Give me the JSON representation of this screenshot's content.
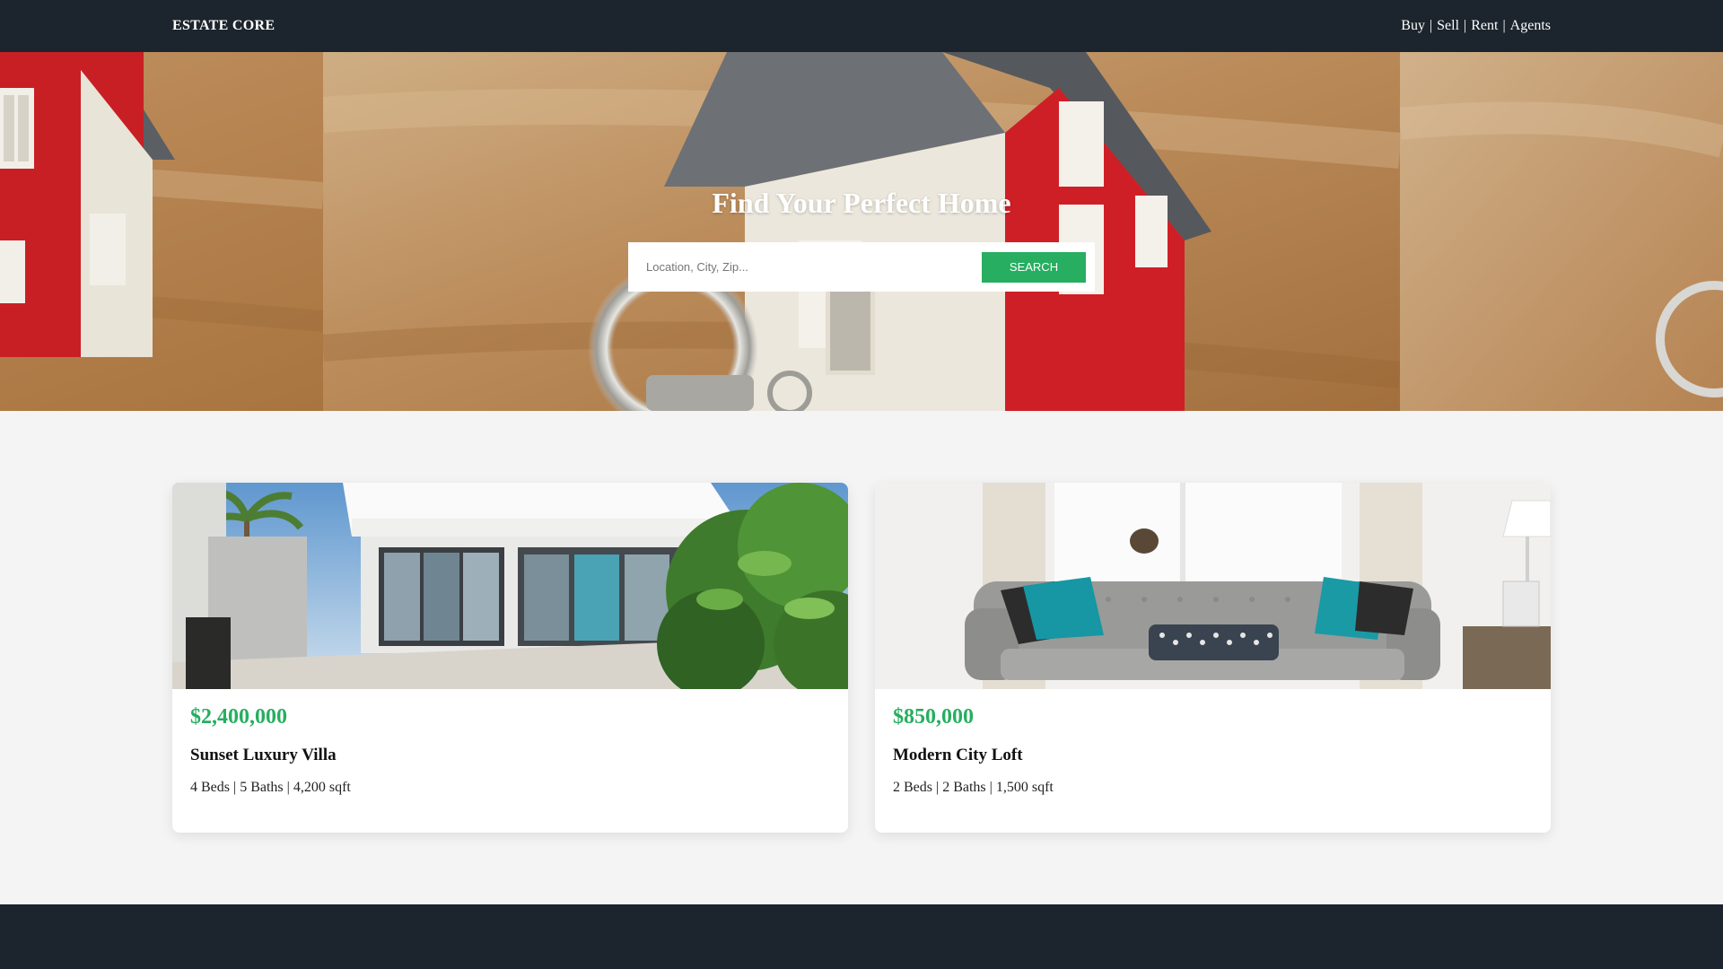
{
  "header": {
    "logo": "ESTATE CORE",
    "nav": [
      {
        "label": "Buy"
      },
      {
        "label": "Sell"
      },
      {
        "label": "Rent"
      },
      {
        "label": "Agents"
      }
    ],
    "separator": "|"
  },
  "hero": {
    "title": "Find Your Perfect Home",
    "search": {
      "placeholder": "Location, City, Zip...",
      "value": "",
      "button_label": "SEARCH"
    }
  },
  "listings": [
    {
      "price": "$2,400,000",
      "title": "Sunset Luxury Villa",
      "specs": "4 Beds | 5 Baths | 4,200 sqft"
    },
    {
      "price": "$850,000",
      "title": "Modern City Loft",
      "specs": "2 Beds | 2 Baths | 1,500 sqft"
    }
  ],
  "colors": {
    "header_bg": "#1c242d",
    "accent": "#27ae60",
    "page_bg": "#f4f4f4",
    "footer_bg": "#1c242d"
  }
}
